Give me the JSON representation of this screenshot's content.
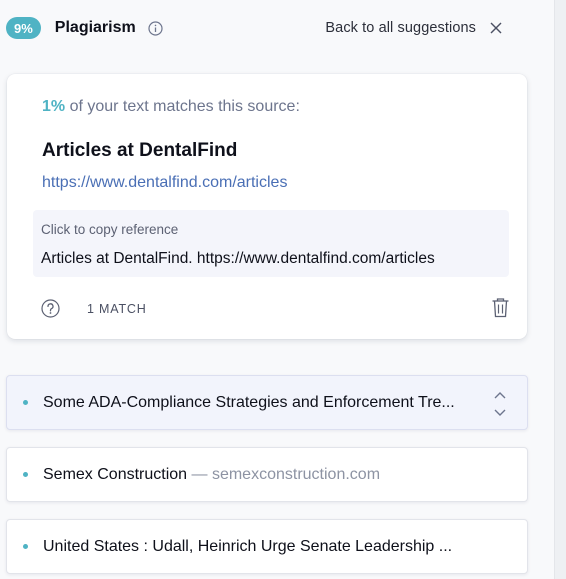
{
  "header": {
    "percent_badge": "9%",
    "title": "Plagiarism",
    "back_label": "Back to all suggestions"
  },
  "card": {
    "match_percent": "1%",
    "match_text": " of your text matches this source:",
    "source_title": "Articles at DentalFind",
    "source_url": "https://www.dentalfind.com/articles",
    "copy_label": "Click to copy reference",
    "copy_reference": "Articles at DentalFind. https://www.dentalfind.com/articles",
    "match_count": "1 MATCH"
  },
  "sources": [
    {
      "text": "Some ADA-Compliance Strategies and Enforcement Tre...",
      "domain": ""
    },
    {
      "text": "Semex Construction",
      "domain": " — semexconstruction.com"
    },
    {
      "text": "United States : Udall, Heinrich Urge Senate Leadership ...",
      "domain": ""
    }
  ],
  "colors": {
    "accent": "#4fb3c4",
    "link": "#4a6fb5",
    "text": "#0e101a",
    "muted": "#6d758d"
  },
  "icons": {
    "info": "info-icon",
    "close": "close-icon",
    "help": "question-circle-icon",
    "trash": "trash-icon",
    "expand": "chevron-up-down-icon"
  }
}
